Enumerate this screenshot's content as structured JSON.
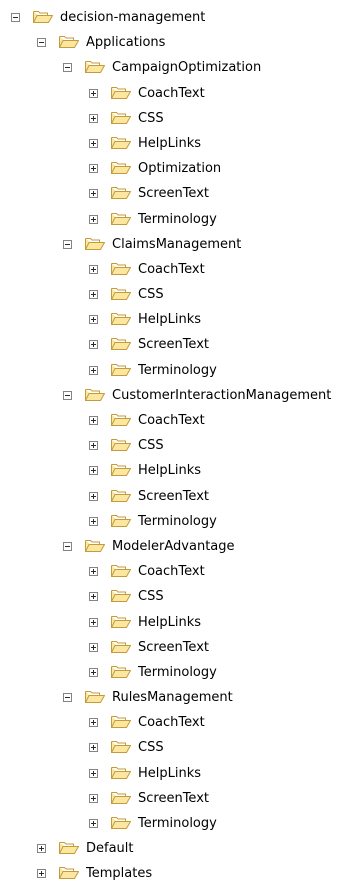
{
  "tree": {
    "root": {
      "label": "decision-management",
      "expanded": true,
      "children": [
        {
          "label": "Applications",
          "expanded": true,
          "children": [
            {
              "label": "CampaignOptimization",
              "expanded": true,
              "children": [
                {
                  "label": "CoachText",
                  "expanded": false
                },
                {
                  "label": "CSS",
                  "expanded": false
                },
                {
                  "label": "HelpLinks",
                  "expanded": false
                },
                {
                  "label": "Optimization",
                  "expanded": false
                },
                {
                  "label": "ScreenText",
                  "expanded": false
                },
                {
                  "label": "Terminology",
                  "expanded": false
                }
              ]
            },
            {
              "label": "ClaimsManagement",
              "expanded": true,
              "children": [
                {
                  "label": "CoachText",
                  "expanded": false
                },
                {
                  "label": "CSS",
                  "expanded": false
                },
                {
                  "label": "HelpLinks",
                  "expanded": false
                },
                {
                  "label": "ScreenText",
                  "expanded": false
                },
                {
                  "label": "Terminology",
                  "expanded": false
                }
              ]
            },
            {
              "label": "CustomerInteractionManagement",
              "expanded": true,
              "children": [
                {
                  "label": "CoachText",
                  "expanded": false
                },
                {
                  "label": "CSS",
                  "expanded": false
                },
                {
                  "label": "HelpLinks",
                  "expanded": false
                },
                {
                  "label": "ScreenText",
                  "expanded": false
                },
                {
                  "label": "Terminology",
                  "expanded": false
                }
              ]
            },
            {
              "label": "ModelerAdvantage",
              "expanded": true,
              "children": [
                {
                  "label": "CoachText",
                  "expanded": false
                },
                {
                  "label": "CSS",
                  "expanded": false
                },
                {
                  "label": "HelpLinks",
                  "expanded": false
                },
                {
                  "label": "ScreenText",
                  "expanded": false
                },
                {
                  "label": "Terminology",
                  "expanded": false
                }
              ]
            },
            {
              "label": "RulesManagement",
              "expanded": true,
              "children": [
                {
                  "label": "CoachText",
                  "expanded": false
                },
                {
                  "label": "CSS",
                  "expanded": false
                },
                {
                  "label": "HelpLinks",
                  "expanded": false
                },
                {
                  "label": "ScreenText",
                  "expanded": false
                },
                {
                  "label": "Terminology",
                  "expanded": false
                }
              ]
            }
          ]
        },
        {
          "label": "Default",
          "expanded": false
        },
        {
          "label": "Templates",
          "expanded": false
        }
      ]
    }
  },
  "icons": {
    "folder": "open-folder-icon",
    "expanded": "collapse-minus-icon",
    "collapsed": "expand-plus-icon"
  },
  "colors": {
    "folder_fill": "#fce7a1",
    "folder_stroke": "#c39b3a",
    "toggle_border": "#848484"
  }
}
